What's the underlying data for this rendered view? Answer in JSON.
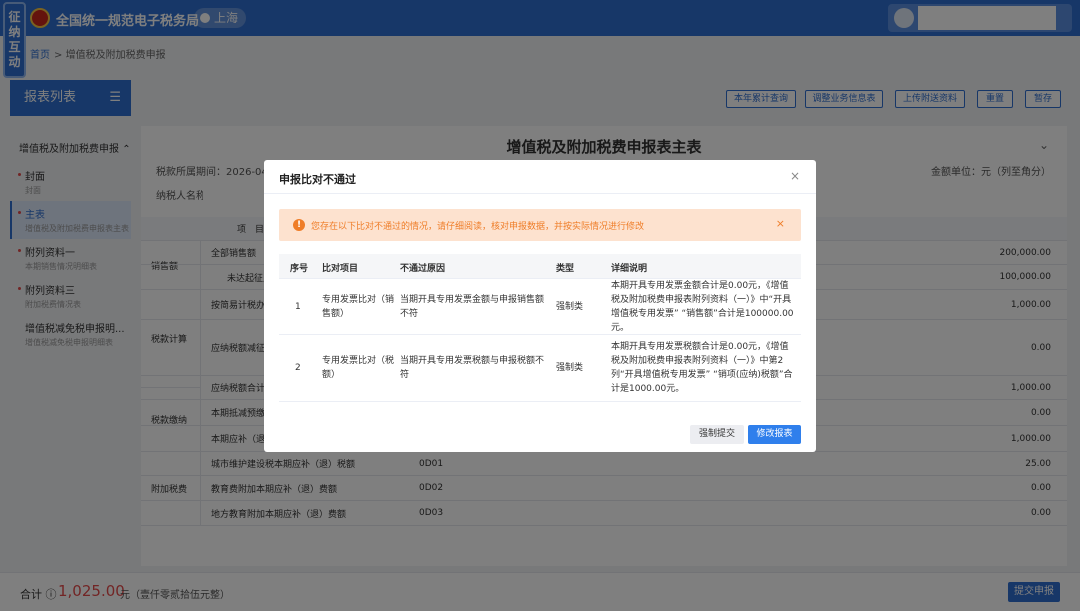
{
  "header": {
    "brand": "全国统一规范电子税务局",
    "region": "上海"
  },
  "interact_tab": "征纳互动",
  "breadcrumb": {
    "home": "首页",
    "sep": ">",
    "current": "增值税及附加税费申报"
  },
  "sidebar": {
    "title": "报表列表",
    "group": "增值税及附加税费申报",
    "group_icon": "chevron-up-icon",
    "items": [
      {
        "label": "封面",
        "sub": "封面"
      },
      {
        "label": "主表",
        "sub": "增值税及附加税费申报表主表"
      },
      {
        "label": "附列资料一",
        "sub": "本期销售情况明细表"
      },
      {
        "label": "附列资料三",
        "sub": "附加税费情况表"
      },
      {
        "label": "增值税减免税申报明...",
        "sub": "增值税减免税申报明细表"
      }
    ]
  },
  "toolbar": [
    "本年累计查询",
    "调整业务信息表",
    "上传附送资料",
    "重置",
    "暂存"
  ],
  "form": {
    "title": "增值税及附加税费申报表主表",
    "period_label": "税款所属期间：2026-04-01",
    "unit_label": "金额单位：元（列至角分）",
    "taxpayer_label": "纳税人名称：",
    "col_item": "项　目",
    "rows": [
      {
        "cat": "销售额",
        "item": "全部销售额",
        "code": "",
        "amount": "200,000.00"
      },
      {
        "cat": "",
        "item": "未达起征点",
        "code": "",
        "amount": "100,000.00"
      },
      {
        "cat": "税款计算",
        "item": "按简易计税办法",
        "code": "",
        "amount": "1,000.00"
      },
      {
        "cat": "",
        "item": "应纳税额减征额",
        "code": "",
        "amount": "0.00"
      },
      {
        "cat": "",
        "item": "应纳税额合计",
        "code": "",
        "amount": "1,000.00"
      },
      {
        "cat": "税款缴纳",
        "item": "本期抵减预缴",
        "code": "",
        "amount": "0.00"
      },
      {
        "cat": "",
        "item": "本期应补（退",
        "code": "",
        "amount": "1,000.00"
      },
      {
        "cat": "附加税费",
        "item": "城市维护建设税本期应补（退）税额",
        "code": "0D01",
        "amount": "25.00"
      },
      {
        "cat": "",
        "item": "教育费附加本期应补（退）费额",
        "code": "0D02",
        "amount": "0.00"
      },
      {
        "cat": "",
        "item": "地方教育附加本期应补（退）费额",
        "code": "0D03",
        "amount": "0.00"
      }
    ]
  },
  "footer": {
    "label": "合计",
    "amount": "1,025.00",
    "unit": "元（壹仟零贰拾伍元整）",
    "submit": "提交申报"
  },
  "modal": {
    "title": "申报比对不通过",
    "warning": "您存在以下比对不通过的情况，请仔细阅读，核对申报数据，并按实际情况进行修改",
    "headers": [
      "序号",
      "比对项目",
      "不通过原因",
      "类型",
      "详细说明"
    ],
    "rows": [
      {
        "no": "1",
        "item": "专用发票比对（销售额）",
        "reason": "当期开具专用发票金额与申报销售额不符",
        "type": "强制类",
        "detail": "本期开具专用发票金额合计是0.00元，《增值税及附加税费申报表附列资料（一）》中“开具增值税专用发票” “销售额”合计是100000.00元。"
      },
      {
        "no": "2",
        "item": "专用发票比对（税额）",
        "reason": "当期开具专用发票税额与申报税额不符",
        "type": "强制类",
        "detail": "本期开具专用发票税额合计是0.00元，《增值税及附加税费申报表附列资料（一）》中第2列“开具增值税专用发票” “销项(应纳)税额”合计是1000.00元。"
      }
    ],
    "btn_force": "强制提交",
    "btn_edit": "修改报表"
  }
}
